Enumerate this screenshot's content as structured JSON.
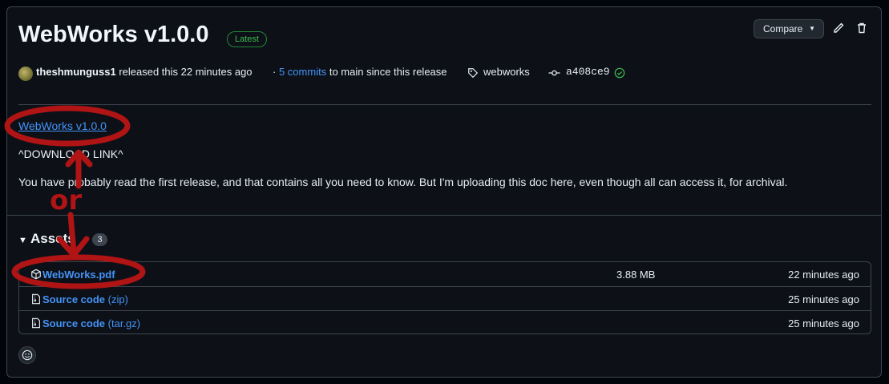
{
  "release": {
    "title": "WebWorks v1.0.0",
    "badge": "Latest",
    "compare_label": "Compare",
    "author": "theshmunguss1",
    "released_text": "released this 22 minutes ago",
    "commits_prefix": "·",
    "commits_link": "5 commits",
    "commits_suffix": "to main since this release",
    "tag": "webworks",
    "commit": "a408ce9"
  },
  "body": {
    "link": "WebWorks v1.0.0",
    "download_line": "^DOWNLOAD LINK^",
    "paragraph": "You have probably read the first release, and that contains all you need to know. But I'm uploading this doc here, even though all can access it, for archival."
  },
  "assets": {
    "title": "Assets",
    "count": "3",
    "rows": [
      {
        "name": "WebWorks.pdf",
        "ext": "",
        "size": "3.88 MB",
        "time": "22 minutes ago",
        "icon": "package-icon"
      },
      {
        "name": "Source code",
        "ext": "(zip)",
        "size": "",
        "time": "25 minutes ago",
        "icon": "file-zip-icon"
      },
      {
        "name": "Source code",
        "ext": "(tar.gz)",
        "size": "",
        "time": "25 minutes ago",
        "icon": "file-zip-icon"
      }
    ]
  },
  "annotation": {
    "handwritten_text": "or",
    "color": "#b01414"
  },
  "colors": {
    "accent_link": "#4493f8",
    "success": "#3fb950",
    "background": "#0d1117"
  }
}
